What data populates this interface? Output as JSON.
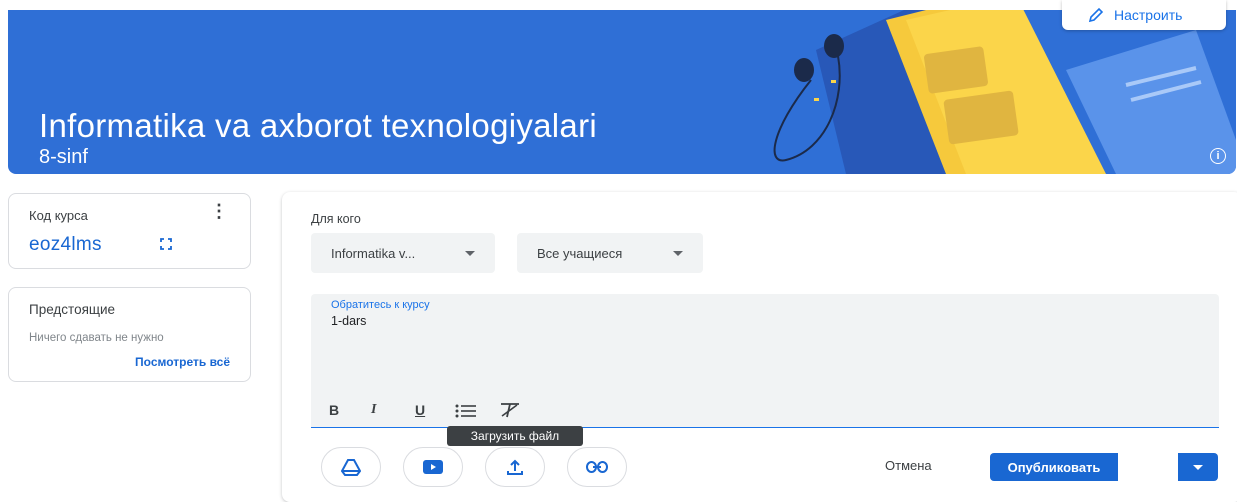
{
  "banner": {
    "title": "Informatika va axborot texnologiyalari",
    "subtitle": "8-sinf",
    "customize_label": "Настроить",
    "bg_color": "#2f6fd6"
  },
  "course_code": {
    "label": "Код курса",
    "value": "eoz4lms"
  },
  "upcoming": {
    "title": "Предстоящие",
    "empty_text": "Ничего сдавать не нужно",
    "view_all": "Посмотреть всё"
  },
  "post": {
    "for_whom_label": "Для кого",
    "class_select": "Informatika v...",
    "students_select": "Все учащиеся",
    "editor_label": "Обратитесь к курсу",
    "editor_text": "1-dars",
    "format_buttons": [
      "B",
      "I",
      "U"
    ],
    "tooltip": "Загрузить файл",
    "cancel": "Отмена",
    "publish": "Опубликовать"
  },
  "icons": {
    "attach": [
      "drive-icon",
      "youtube-icon",
      "upload-icon",
      "link-icon"
    ]
  },
  "colors": {
    "accent": "#1967d2",
    "editor_bg": "#f1f3f4"
  }
}
